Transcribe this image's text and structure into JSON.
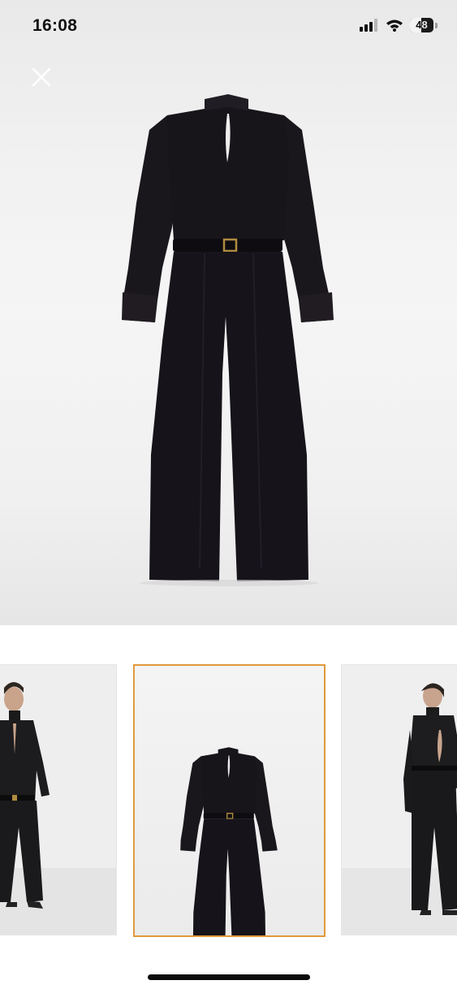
{
  "status_bar": {
    "time": "16:08",
    "battery_level": "48",
    "icons": [
      "cellular-signal-icon",
      "wifi-icon",
      "battery-icon"
    ]
  },
  "viewer": {
    "close_icon": "close-icon",
    "main_image": "black-belted-jumpsuit-front-flatlay",
    "selected_index": 2
  },
  "thumbnails": [
    {
      "image": "model-wearing-jumpsuit-front",
      "selected": false
    },
    {
      "image": "black-belted-jumpsuit-front-flatlay",
      "selected": true
    },
    {
      "image": "model-wearing-jumpsuit-back",
      "selected": false
    }
  ],
  "colors": {
    "selected_border": "#e09a3c",
    "garment": "#17141a",
    "background": "#f2f2f2"
  }
}
